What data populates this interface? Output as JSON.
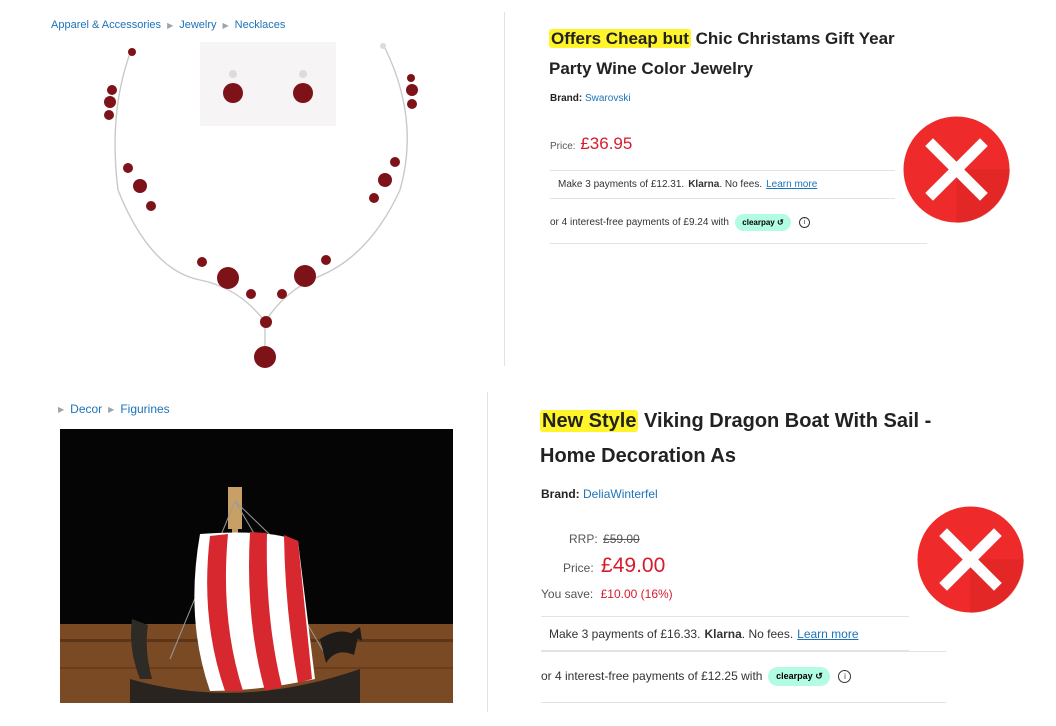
{
  "listing_1": {
    "breadcrumb": [
      "Apparel & Accessories",
      "Jewelry",
      "Necklaces"
    ],
    "title_highlight": "Offers Cheap but",
    "title_line1_rest": " Chic Christams Gift Year",
    "title_line2": "Party Wine Color Jewelry",
    "brand_label": "Brand:",
    "brand_value": "Swarovski",
    "price_label": "Price:",
    "price_value": "£36.95",
    "klarna": {
      "prefix": "Make 3 payments of £12.31.",
      "brand": "Klarna",
      "suffix": ". No fees.",
      "link": "Learn more"
    },
    "clearpay": {
      "text": "or 4 interest-free payments of £9.24 with",
      "badge": "clearpay",
      "info": "i"
    },
    "image_icon": "necklace-earrings-product-photo",
    "status_icon": "red-x-icon"
  },
  "listing_2": {
    "breadcrumb": [
      "Decor",
      "Figurines"
    ],
    "title_highlight": "New Style",
    "title_line1_rest": " Viking Dragon Boat With Sail -",
    "title_line2": "Home Decoration As",
    "brand_label": "Brand:",
    "brand_value": "DeliaWinterfel",
    "rrp_label": "RRP:",
    "rrp_value": "£59.00",
    "price_label": "Price:",
    "price_value": "£49.00",
    "save_label": "You save:",
    "save_value": "£10.00 (16%)",
    "klarna": {
      "prefix": "Make 3 payments of £16.33.",
      "brand": "Klarna",
      "suffix": ". No fees.",
      "link": "Learn more"
    },
    "clearpay": {
      "text": "or 4 interest-free payments of £12.25 with",
      "badge": "clearpay",
      "info": "i"
    },
    "image_icon": "viking-boat-product-photo",
    "status_icon": "red-x-icon"
  },
  "colors": {
    "link": "#1d73b8",
    "price": "#d81b2b",
    "highlight": "#fff52a",
    "badge": "#b2fce4",
    "error": "#ee2a2a"
  }
}
